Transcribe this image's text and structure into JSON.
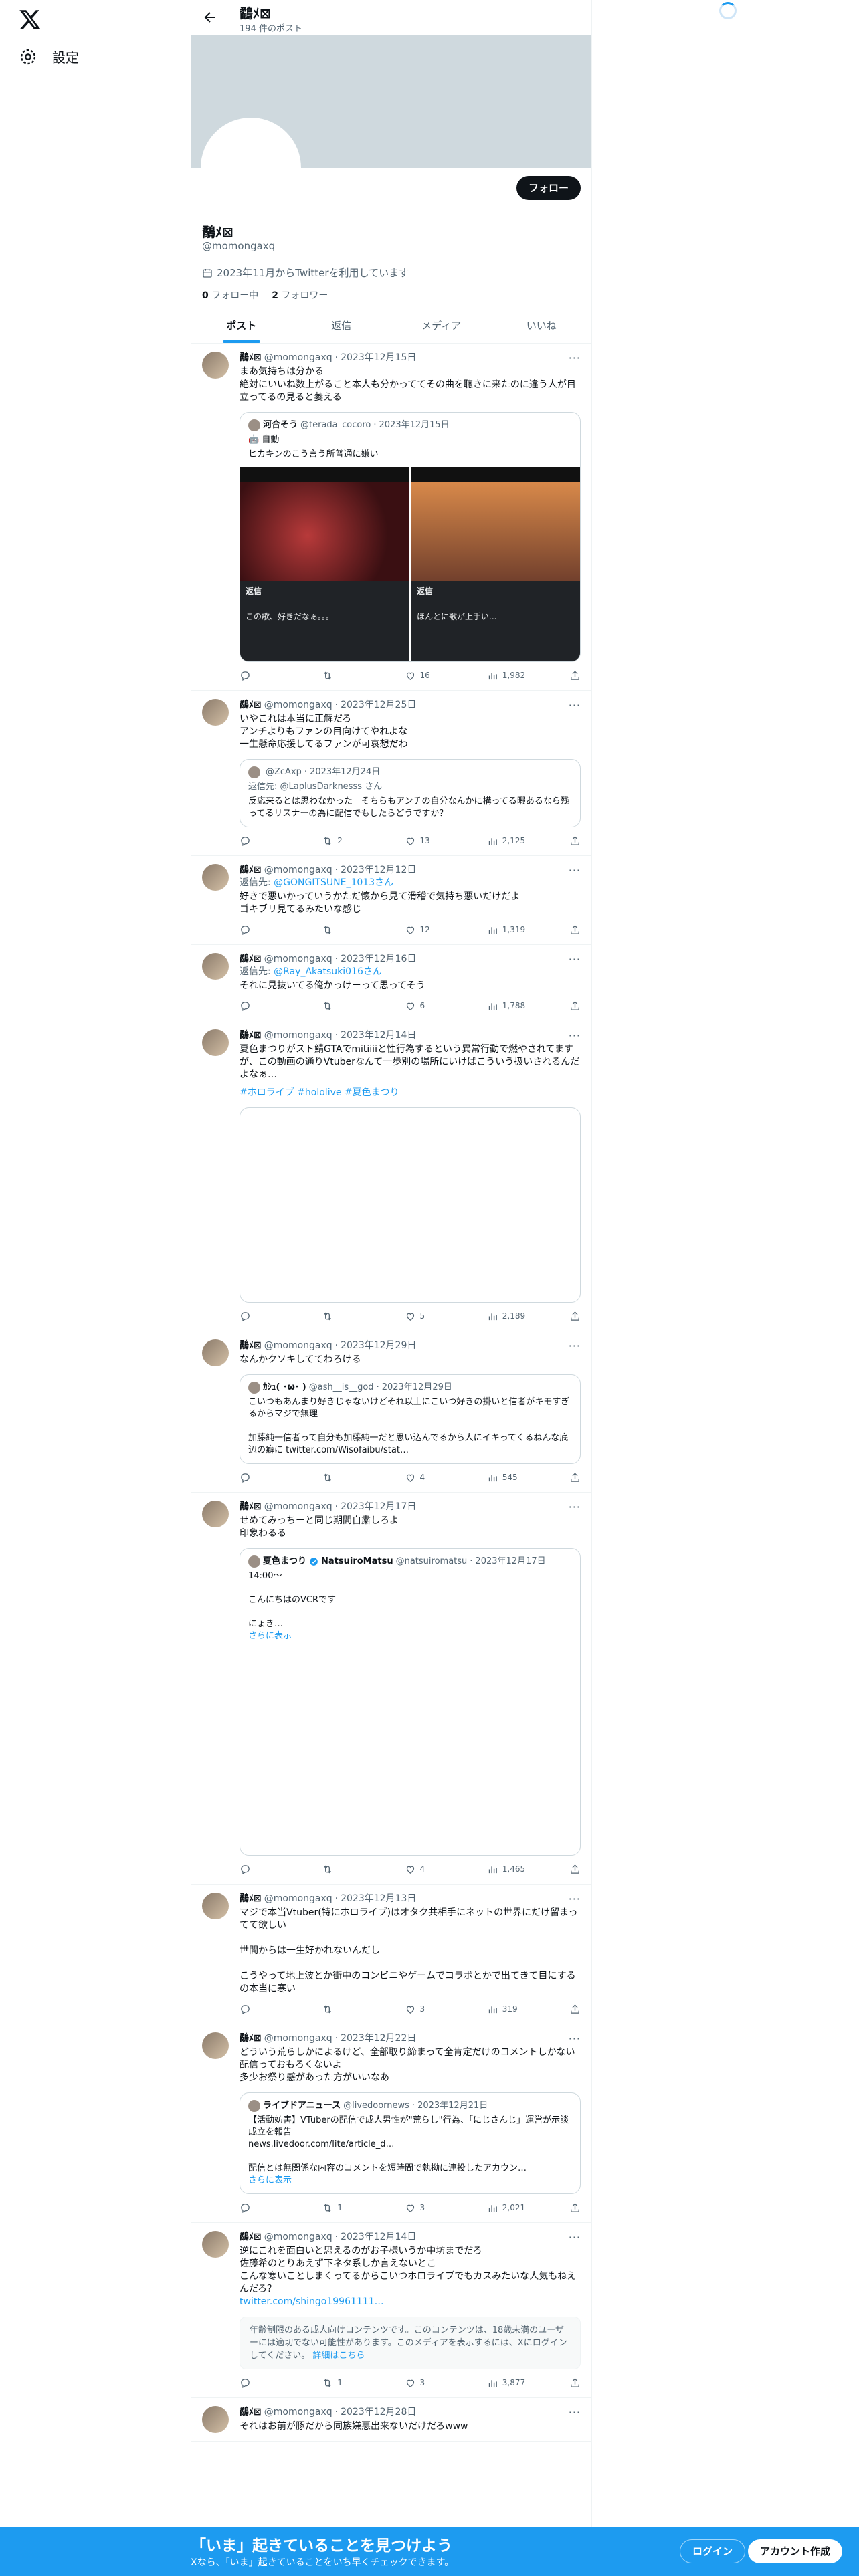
{
  "nav": {
    "settings_label": "設定"
  },
  "profile": {
    "display_name": "鷸ﾒ⊠",
    "handle": "@momongaxq",
    "post_count": "194 件のポスト",
    "joined": "2023年11月からTwitterを利用しています",
    "following_count": "0",
    "following_label": "フォロー中",
    "followers_count": "2",
    "followers_label": "フォロワー",
    "follow_button": "フォロー"
  },
  "tabs": [
    "ポスト",
    "返信",
    "メディア",
    "いいね"
  ],
  "tweets": [
    {
      "date": "2023年12月15日",
      "text": "まあ気持ちは分かる\n絶対にいいね数上がること本人も分かっててその曲を聴きに来たのに違う人が目立ってるの見ると萎える",
      "quote": {
        "name": "河合そう",
        "handle": "@terada_cocoro",
        "date": "2023年12月15日",
        "label": "自動",
        "text": "ヒカキンのこう言う所普通に嫌い",
        "shot_a_title": "返信",
        "shot_a_text": "この歌、好きだなぁ。。。",
        "shot_b_title": "返信",
        "shot_b_text": "ほんとに歌が上手い..."
      },
      "stats": {
        "reply": "",
        "retweet": "",
        "like": "16",
        "views": "1,982"
      }
    },
    {
      "date": "2023年12月25日",
      "text": "いやこれは本当に正解だろ\nアンチよりもファンの目向けてやれよな\n一生懸命応援してるファンが可哀想だわ",
      "quote": {
        "name": "",
        "handle": "@ZcAxp",
        "date": "2023年12月24日",
        "reply_to": "返信先: @LaplusDarknesss さん",
        "text": "反応来るとは思わなかった　そちらもアンチの自分なんかに構ってる暇あるなら残ってるリスナーの為に配信でもしたらどうですか？"
      },
      "stats": {
        "reply": "",
        "retweet": "2",
        "like": "13",
        "views": "2,125"
      }
    },
    {
      "date": "2023年12月12日",
      "reply_label": "返信先:",
      "reply_handle": "@GONGITSUNE_1013さん",
      "text": "好きで悪いかっていうかただ懐から見て滑稽で気持ち悪いだけだよ\nゴキブリ見てるみたいな感じ",
      "stats": {
        "reply": "",
        "retweet": "",
        "like": "12",
        "views": "1,319"
      }
    },
    {
      "date": "2023年12月16日",
      "reply_label": "返信先:",
      "reply_handle": "@Ray_Akatsuki016さん",
      "text": "それに見抜いてる俺かっけーって思ってそう",
      "stats": {
        "reply": "",
        "retweet": "",
        "like": "6",
        "views": "1,788"
      }
    },
    {
      "date": "2023年12月14日",
      "text": "夏色まつりがスト鯖GTAでmitiiiiと性行為するという異常行動で燃やされてますが、この動画の通りVtuberなんて一歩別の場所にいけばこういう扱いされるんだよなぁ…",
      "hashtags": "#ホロライブ #hololive #夏色まつり",
      "stats": {
        "reply": "",
        "retweet": "",
        "like": "5",
        "views": "2,189"
      }
    },
    {
      "date": "2023年12月29日",
      "text": "なんかクソキしててわろける",
      "quote": {
        "name": "ｶｼｭ( ･ω･ )",
        "handle": "@ash__is__god",
        "date": "2023年12月29日",
        "text": "こいつもあんまり好きじゃないけどそれ以上にこいつ好きの掛いと信者がキモすぎるからマジで無理\n\n加藤純一信者って自分も加藤純一だと思い込んでるから人にイキってくるねんな底辺の癖に twitter.com/Wisofaibu/stat…"
      },
      "stats": {
        "reply": "",
        "retweet": "",
        "like": "4",
        "views": "545"
      }
    },
    {
      "date": "2023年12月17日",
      "text": "せめてみっちーと同じ期間自粛しろよ\n印象わるる",
      "quote": {
        "name": "夏色まつり",
        "name2": "NatsuiroMatsu",
        "handle": "@natsuiromatsu",
        "date": "2023年12月17日",
        "text": "14:00〜\n\nこんにちはのVCRです\n\nにょき…",
        "more": "さらに表示"
      },
      "stats": {
        "reply": "",
        "retweet": "",
        "like": "4",
        "views": "1,465"
      }
    },
    {
      "date": "2023年12月13日",
      "text": "マジで本当Vtuber(特にホロライブ)はオタク共相手にネットの世界にだけ留まってて欲しい\n\n世間からは一生好かれないんだし\n\nこうやって地上波とか街中のコンビニやゲームでコラボとかで出てきて目にするの本当に寒い",
      "stats": {
        "reply": "",
        "retweet": "",
        "like": "3",
        "views": "319"
      }
    },
    {
      "date": "2023年12月22日",
      "text": "どういう荒らしかによるけど、全部取り締まって全肯定だけのコメントしかない配信っておもろくないよ\n多少お祭り感があった方がいいなあ",
      "quote": {
        "name": "ライブドアニュース",
        "handle": "@livedoornews",
        "date": "2023年12月21日",
        "text": "【活動妨害】VTuberの配信で成人男性が\"荒らし\"行為、「にじさんじ」運営が示談成立を報告\nnews.livedoor.com/lite/article_d…\n\n配信とは無関係な内容のコメントを短時間で執拗に連投したアカウン…",
        "more": "さらに表示"
      },
      "stats": {
        "reply": "",
        "retweet": "1",
        "like": "3",
        "views": "2,021"
      }
    },
    {
      "date": "2023年12月14日",
      "text": "逆にこれを面白いと思えるのがお子様いうか中坊までだろ\n佐藤希のとりあえず下ネタ系しか言えないとこ\nこんな寒いことしまくってるからこいつホロライブでもカスみたいな人気もねえんだろ？",
      "link": "twitter.com/shingo19961111…",
      "notice": "年齢制限のある成人向けコンテンツです。このコンテンツは、18歳未満のユーザーには適切でない可能性があります。このメディアを表示するには、Xにログインしてください。",
      "notice_link": "詳細はこちら",
      "stats": {
        "reply": "",
        "retweet": "1",
        "like": "3",
        "views": "3,877"
      }
    },
    {
      "date": "2023年12月28日",
      "text": "それはお前が豚だから同族嫌悪出来ないだけだろwww"
    }
  ],
  "bottom_bar": {
    "title": "「いま」起きていることを見つけよう",
    "subtitle": "Xなら、「いま」起きていることをいち早くチェックできます。",
    "login": "ログイン",
    "signup": "アカウント作成"
  }
}
